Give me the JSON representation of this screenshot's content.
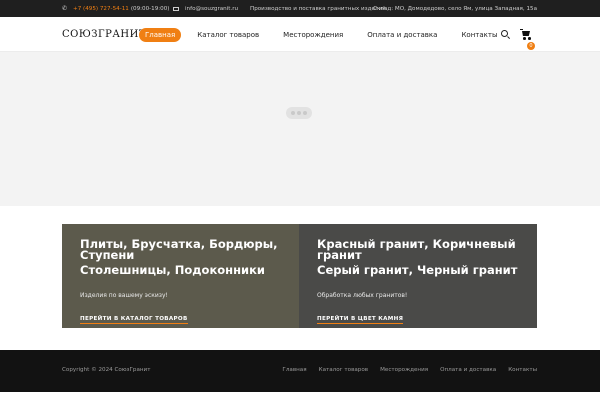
{
  "topbar": {
    "phone": "+7 (495) 727-54-11",
    "hours": "(09:00-19:00)",
    "email": "info@souzgranit.ru",
    "tagline": "Производство и поставка гранитных изделий",
    "address": "Склад: МО, Домодедово, село Ям, улица Западная, 15а"
  },
  "header": {
    "logo": "СОЮЗГРАНИТ",
    "nav": [
      "Главная",
      "Каталог товаров",
      "Месторождения",
      "Оплата и доставка",
      "Контакты"
    ],
    "cart_count": "0"
  },
  "panels": [
    {
      "title1": "Плиты, Брусчатка, Бордюры, Ступени",
      "title2": "Столешницы, Подоконники",
      "subtitle": "Изделия по вашему эскизу!",
      "link": "ПЕРЕЙТИ В КАТАЛОГ ТОВАРОВ",
      "color": "#5c5a4c"
    },
    {
      "title1": "Красный гранит, Коричневый гранит",
      "title2": "Серый гранит, Черный гранит",
      "subtitle": "Обработка любых гранитов!",
      "link": "ПЕРЕЙТИ В ЦВЕТ КАМНЯ",
      "color": "#4a4a48"
    }
  ],
  "footer": {
    "copyright": "Copyright © 2024 СоюзГранит",
    "nav": [
      "Главная",
      "Каталог товаров",
      "Месторождения",
      "Оплата и доставка",
      "Контакты"
    ]
  },
  "colors": {
    "accent": "#f07f13",
    "topbar": "#1f1f1f",
    "footer": "#121212"
  }
}
